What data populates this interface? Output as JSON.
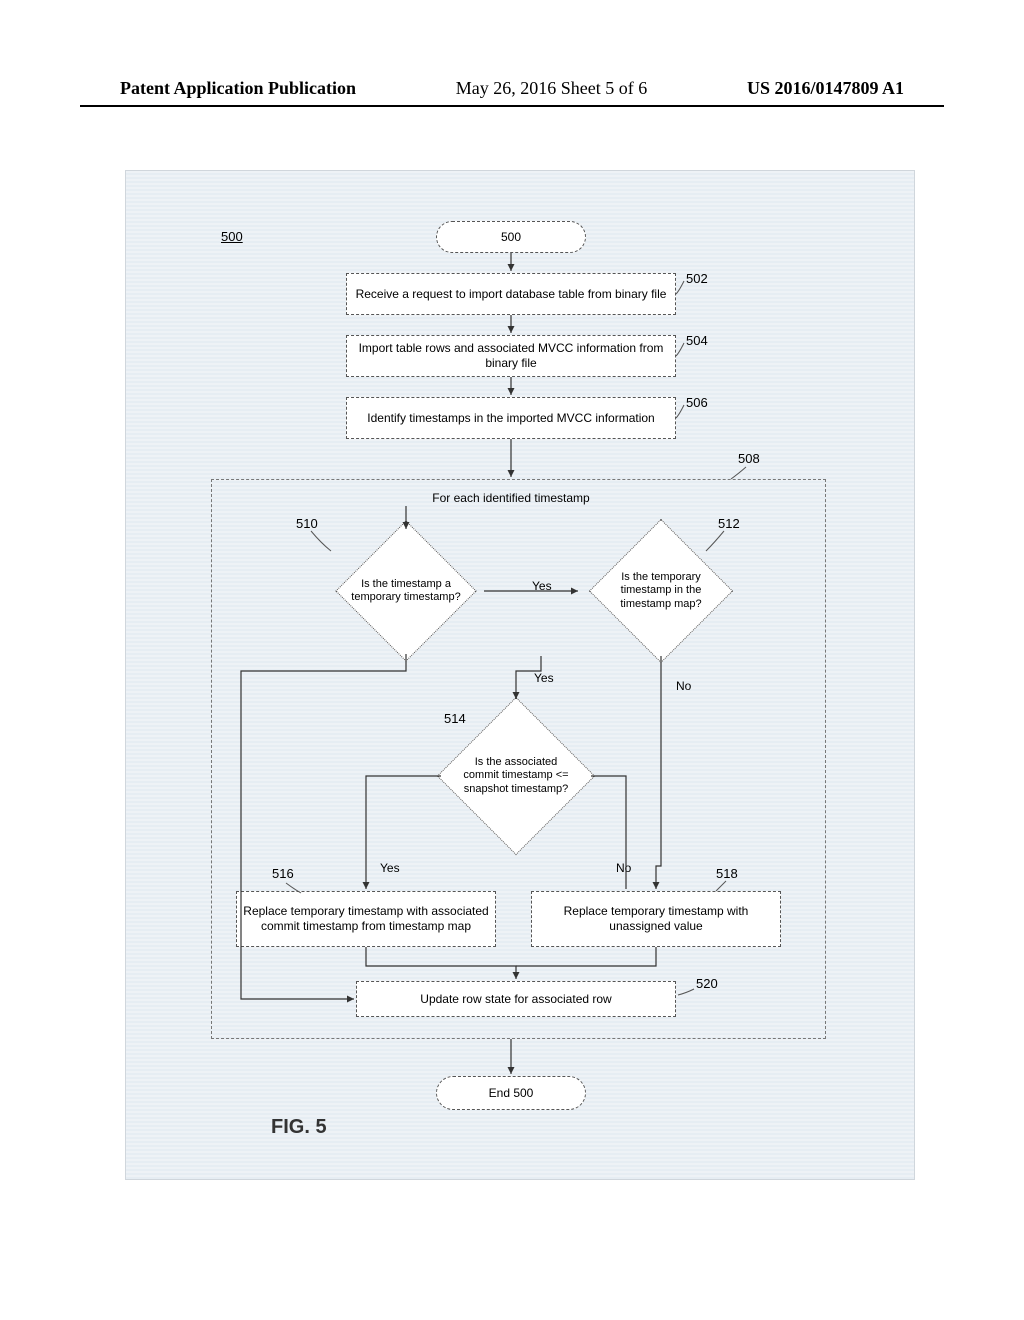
{
  "header": {
    "left": "Patent Application Publication",
    "center": "May 26, 2016  Sheet 5 of 6",
    "right": "US 2016/0147809 A1"
  },
  "refs": {
    "r500a": "500",
    "r500b": "500",
    "r502": "502",
    "r504": "504",
    "r506": "506",
    "r508": "508",
    "r510": "510",
    "r512": "512",
    "r514": "514",
    "r516": "516",
    "r518": "518",
    "r520": "520"
  },
  "loop": {
    "title": "For each identified timestamp"
  },
  "nodes": {
    "start": "500",
    "n502": "Receive a request to import database table from binary file",
    "n504": "Import table rows and associated MVCC information from binary file",
    "n506": "Identify timestamps in the imported MVCC information",
    "d510": "Is the timestamp a temporary timestamp?",
    "d512": "Is the temporary timestamp in the timestamp map?",
    "d514": "Is the associated commit timestamp <= snapshot timestamp?",
    "n516": "Replace temporary timestamp with associated commit timestamp from timestamp map",
    "n518": "Replace temporary timestamp with unassigned value",
    "n520": "Update row state for associated row",
    "end": "End 500"
  },
  "edge_labels": {
    "yes1": "Yes",
    "yes2": "Yes",
    "yes3": "Yes",
    "no1": "No",
    "no2": "No"
  },
  "figure_label": "FIG. 5"
}
